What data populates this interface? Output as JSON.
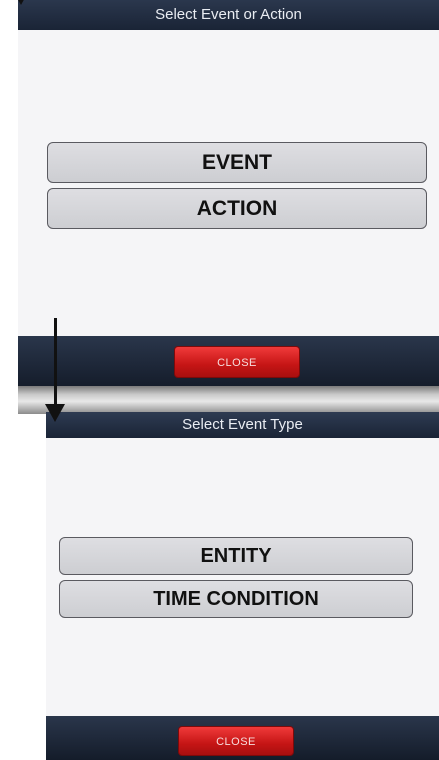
{
  "panel_1": {
    "title": "Select Event or Action",
    "options": [
      "EVENT",
      "ACTION"
    ],
    "close_label": "CLOSE"
  },
  "panel_2": {
    "title": "Select Event Type",
    "options": [
      "ENTITY",
      "TIME CONDITION"
    ],
    "close_label": "CLOSE"
  },
  "colors": {
    "title_bar": "#1f2a3d",
    "panel_background": "#f5f5f7",
    "button_fill": "#d6d6da",
    "close_button": "#d41c1c",
    "arrow": "#111111"
  },
  "icons": [
    "down-arrow-icon"
  ]
}
